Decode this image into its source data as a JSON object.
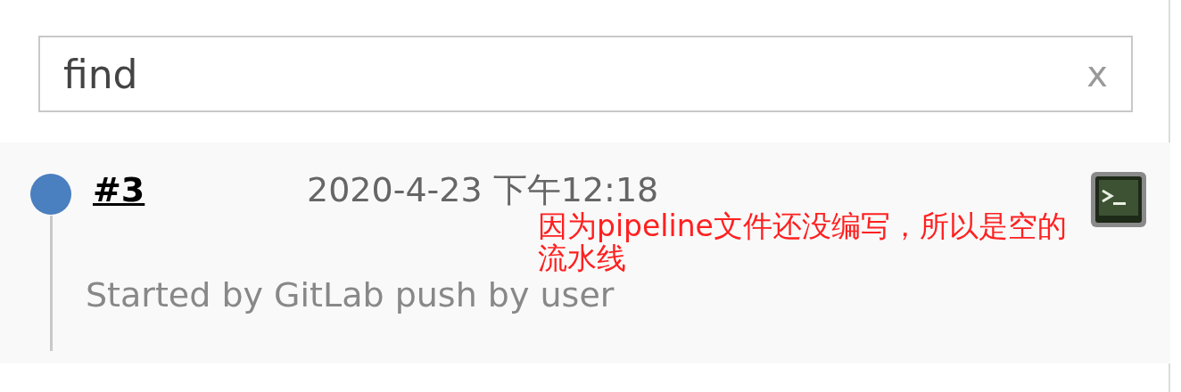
{
  "search": {
    "value": "find",
    "clear_label": "x"
  },
  "builds": [
    {
      "number": "#3",
      "color": "#4a7fc0",
      "date": "2020-4-23 下午12:18",
      "cause": "Started by GitLab push by user",
      "annotation": "因为pipeline文件还没编写，所以是空的流水线"
    }
  ]
}
